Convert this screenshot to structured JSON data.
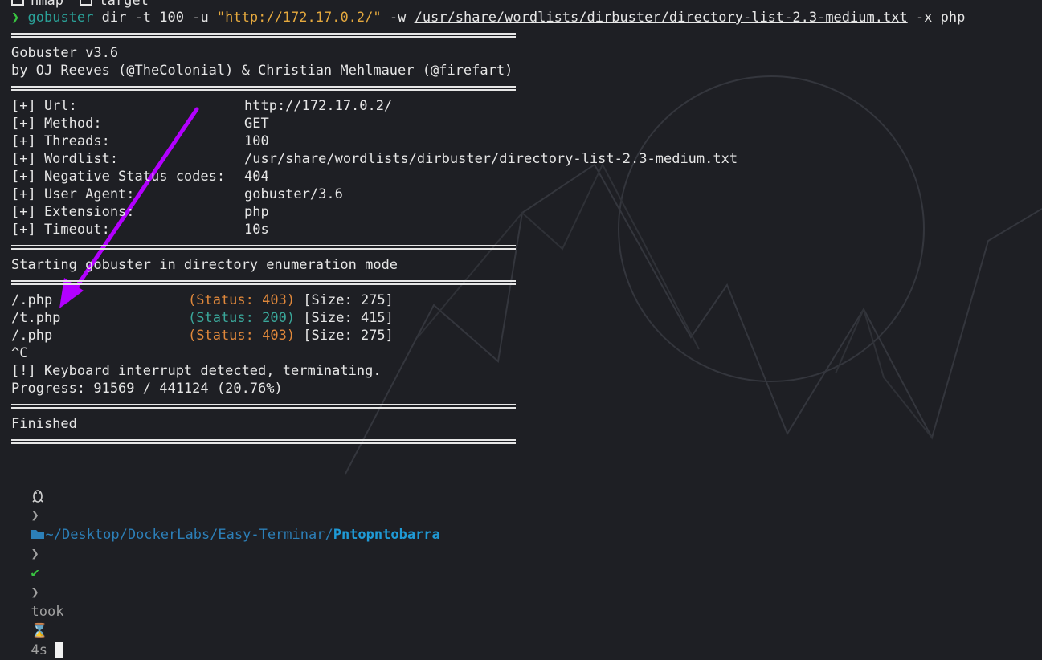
{
  "tabs": [
    "nmap",
    "target"
  ],
  "command": {
    "prompt_char": "❯",
    "program": "gobuster",
    "args1": " dir -t 100 -u ",
    "url": "\"http://172.17.0.2/\"",
    "flag_w": " -w ",
    "wordlist": "/usr/share/wordlists/dirbuster/directory-list-2.3-medium.txt",
    "rest": " -x php"
  },
  "banner": {
    "version": "Gobuster v3.6",
    "authors": "by OJ Reeves (@TheColonial) & Christian Mehlmauer (@firefart)"
  },
  "config": [
    {
      "key": "[+] Url:",
      "value": "http://172.17.0.2/"
    },
    {
      "key": "[+] Method:",
      "value": "GET"
    },
    {
      "key": "[+] Threads:",
      "value": "100"
    },
    {
      "key": "[+] Wordlist:",
      "value": "/usr/share/wordlists/dirbuster/directory-list-2.3-medium.txt"
    },
    {
      "key": "[+] Negative Status codes:",
      "value": "404"
    },
    {
      "key": "[+] User Agent:",
      "value": "gobuster/3.6"
    },
    {
      "key": "[+] Extensions:",
      "value": "php"
    },
    {
      "key": "[+] Timeout:",
      "value": "10s"
    }
  ],
  "starting": "Starting gobuster in directory enumeration mode",
  "results": [
    {
      "path": "/.php",
      "status": "(Status: 403)",
      "code": "403",
      "size": "[Size: 275]"
    },
    {
      "path": "/t.php",
      "status": "(Status: 200)",
      "code": "200",
      "size": "[Size: 415]"
    },
    {
      "path": "/.php",
      "status": "(Status: 403)",
      "code": "403",
      "size": "[Size: 275]"
    }
  ],
  "interrupt_char": "^C",
  "interrupt_msg": "[!] Keyboard interrupt detected, terminating.",
  "progress": "Progress: 91569 / 441124 (20.76%)",
  "finished": "Finished",
  "prompt": {
    "os_icon": "linux-icon",
    "folder_icon": "folder-icon",
    "path_prefix": "~/Desktop/DockerLabs/Easy-Terminar/",
    "path_current": "Pntopntobarra",
    "check": "✔",
    "took_label": "took",
    "hourglass": "⌛",
    "duration": "4s"
  },
  "colors": {
    "background": "#1e1f24",
    "arrow": "#b300ff",
    "status_403": "#e0883b",
    "status_200": "#3aa79a"
  }
}
